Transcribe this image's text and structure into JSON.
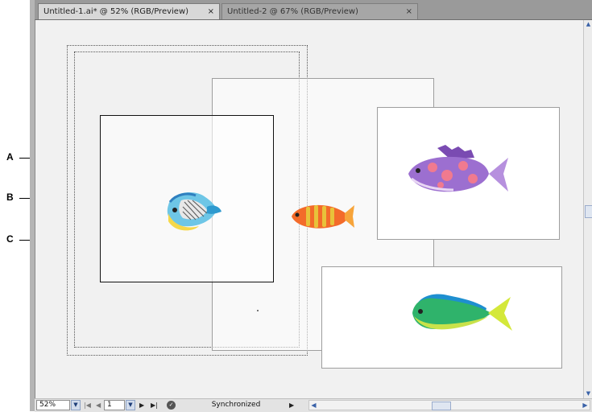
{
  "tabs": [
    {
      "title": "Untitled-1.ai* @ 52% (RGB/Preview)",
      "close": "×",
      "active": true
    },
    {
      "title": "Untitled-2 @ 67% (RGB/Preview)",
      "close": "×",
      "active": false
    }
  ],
  "callouts": [
    {
      "label": "A"
    },
    {
      "label": "B"
    },
    {
      "label": "C"
    }
  ],
  "status_bar": {
    "zoom": "52%",
    "page": "1",
    "status_text": "Synchronized"
  },
  "artwork": [
    "butterfly-fish",
    "orange-striped-fish",
    "purple-spotted-fish",
    "mahi-mahi-fish"
  ],
  "colors": {
    "canvas": "#f1f1f1",
    "tabbar": "#9a9a9a",
    "active_tab": "#d8d8d8"
  }
}
